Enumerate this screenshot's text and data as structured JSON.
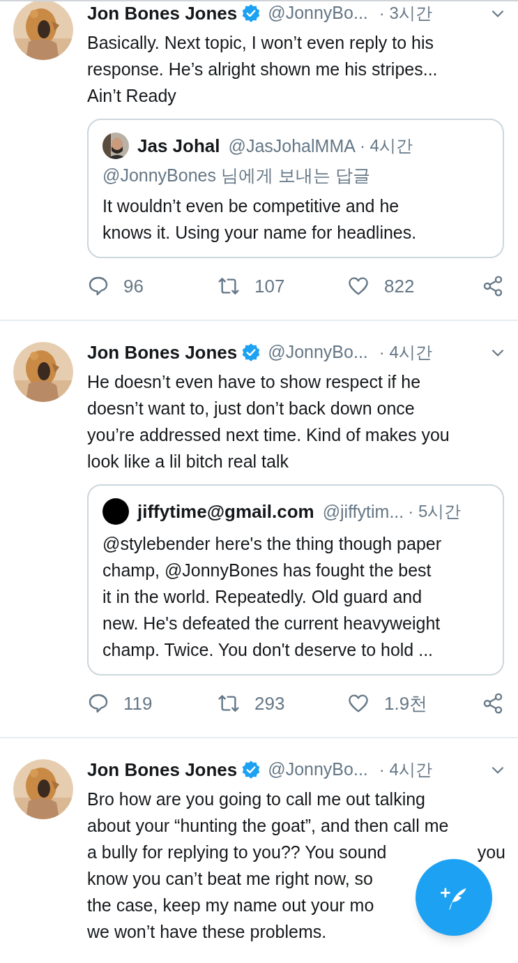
{
  "tweets": [
    {
      "name": "Jon Bones Jones",
      "verified": true,
      "handle": "@JonnyBo...",
      "time": "· 3시간",
      "lines": [
        [
          "Basically. Next topic, I won’t even reply to his"
        ],
        [
          "response. He’s alright shown me his stripes..."
        ],
        [
          "Ain’t Ready"
        ]
      ],
      "quote": {
        "name": "Jas Johal",
        "handle": "@JasJohalMMA",
        "time": "· 4시간",
        "kind": "picture",
        "reply_to": "@JonnyBones 님에게 보내는 답글",
        "lines": [
          "It wouldn’t even be competitive and he",
          "knows it. Using your name for headlines."
        ]
      },
      "actions": {
        "replies": "96",
        "retweets": "107",
        "likes": "822"
      }
    },
    {
      "name": "Jon Bones Jones",
      "verified": true,
      "handle": "@JonnyBo...",
      "time": "· 4시간",
      "lines": [
        [
          "He doesn’t even have to show respect if he"
        ],
        [
          "doesn’t want to, just don’t back down once"
        ],
        [
          "you’re addressed next time. Kind of makes you"
        ],
        [
          "look like a lil bitch real talk"
        ]
      ],
      "quote": {
        "name": "jiffytime@gmail.com",
        "handle": "@jiffytim...",
        "time": "· 5시간",
        "kind": "blank",
        "lines": [
          "@stylebender here's the thing though paper",
          "champ, @JonnyBones has fought the best",
          "it in the world. Repeatedly. Old guard and",
          "new. He's defeated the current heavyweight",
          "champ. Twice. You don't deserve to hold ..."
        ]
      },
      "actions": {
        "replies": "119",
        "retweets": "293",
        "likes": "1.9천"
      }
    },
    {
      "name": "Jon Bones Jones",
      "verified": true,
      "handle": "@JonnyBo...",
      "time": "· 4시간",
      "lines": [
        [
          "Bro how are you going to call me out talking"
        ],
        [
          "about your “hunting the goat”, and then call me"
        ],
        [
          "a bully for replying to you?? You sound",
          "you"
        ],
        [
          "know you can’t beat me right now, so"
        ],
        [
          "the case, keep my name out your mo"
        ],
        [
          "we won’t have these problems."
        ]
      ]
    }
  ]
}
